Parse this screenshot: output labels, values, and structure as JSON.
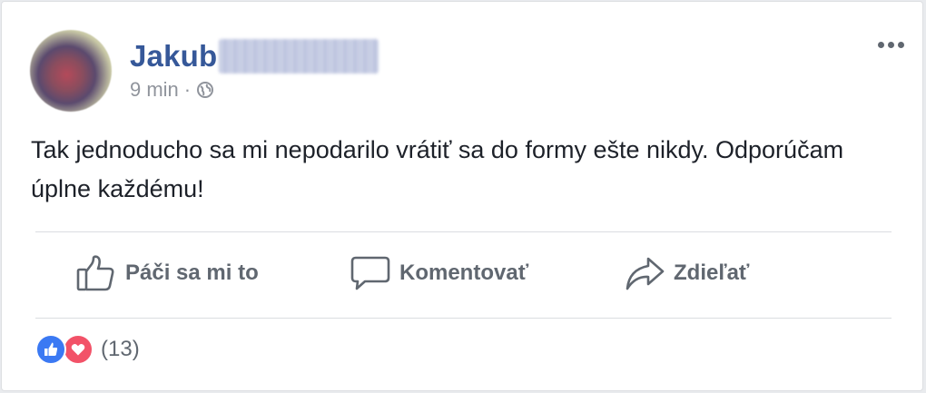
{
  "post": {
    "author_first_name": "Jakub",
    "author_surname_obscured": true,
    "time": "9 min",
    "separator": "·",
    "privacy_icon": "globe-icon",
    "text": "Tak jednoducho sa mi nepodarilo vrátiť sa do formy ešte nikdy. Odporúčam úplne každému!"
  },
  "actions": {
    "like_label": "Páči sa mi to",
    "comment_label": "Komentovať",
    "share_label": "Zdieľať"
  },
  "reactions": {
    "icons": [
      "like-reaction-icon",
      "love-reaction-icon"
    ],
    "count": "(13)"
  },
  "colors": {
    "name": "#365899",
    "meta": "#90949c",
    "text": "#1d2129",
    "action": "#606770",
    "like": "#3b79f3",
    "love": "#f25268"
  }
}
